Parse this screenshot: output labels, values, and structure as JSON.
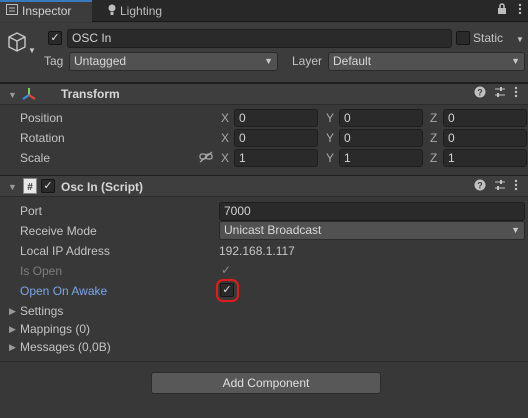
{
  "tabs": [
    {
      "label": "Inspector",
      "icon": "inspector-icon"
    },
    {
      "label": "Lighting",
      "icon": "lightbulb-icon"
    }
  ],
  "header": {
    "active": true,
    "name": "OSC In",
    "static_label": "Static",
    "tag_label": "Tag",
    "tag_value": "Untagged",
    "layer_label": "Layer",
    "layer_value": "Default"
  },
  "transform": {
    "title": "Transform",
    "rows": [
      {
        "label": "Position",
        "x": "0",
        "y": "0",
        "z": "0"
      },
      {
        "label": "Rotation",
        "x": "0",
        "y": "0",
        "z": "0"
      },
      {
        "label": "Scale",
        "x": "1",
        "y": "1",
        "z": "1"
      }
    ],
    "axis": [
      "X",
      "Y",
      "Z"
    ]
  },
  "script": {
    "title": "Osc In (Script)",
    "port_label": "Port",
    "port_value": "7000",
    "receive_label": "Receive Mode",
    "receive_value": "Unicast Broadcast",
    "ip_label": "Local IP Address",
    "ip_value": "192.168.1.117",
    "isopen_label": "Is Open",
    "isopen_checked": true,
    "awake_label": "Open On Awake",
    "awake_checked": true,
    "foldouts": [
      "Settings",
      "Mappings (0)",
      "Messages (0,0B)"
    ]
  },
  "add_component": "Add Component",
  "colors": {
    "accent": "#3a79bb",
    "highlight": "#e11b1b",
    "link": "#7aa6e8"
  }
}
